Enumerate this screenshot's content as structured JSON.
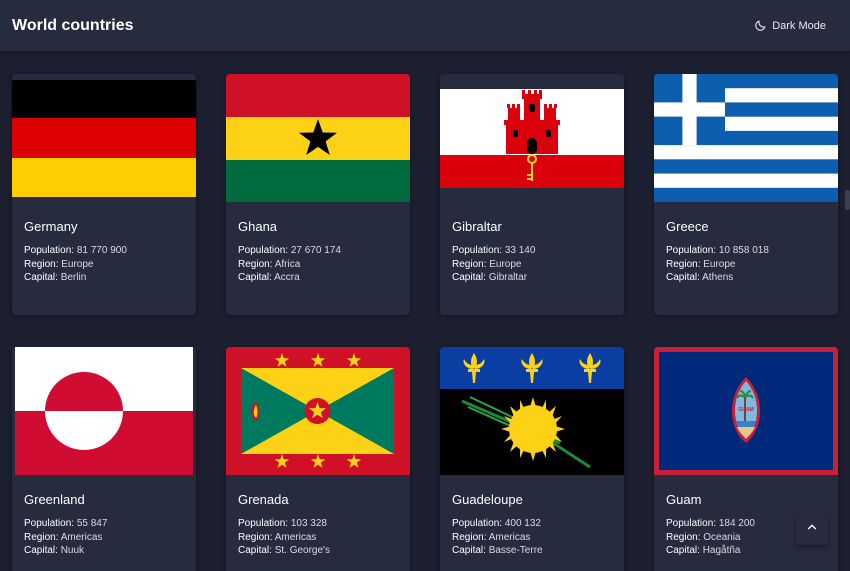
{
  "header": {
    "title": "World countries",
    "mode_label": "Dark Mode",
    "mode_icon": "moon-icon"
  },
  "labels": {
    "population": "Population:",
    "region": "Region:",
    "capital": "Capital:"
  },
  "countries": [
    {
      "name": "Germany",
      "population": "81 770 900",
      "region": "Europe",
      "capital": "Berlin"
    },
    {
      "name": "Ghana",
      "population": "27 670 174",
      "region": "Africa",
      "capital": "Accra"
    },
    {
      "name": "Gibraltar",
      "population": "33 140",
      "region": "Europe",
      "capital": "Gibraltar"
    },
    {
      "name": "Greece",
      "population": "10 858 018",
      "region": "Europe",
      "capital": "Athens"
    },
    {
      "name": "Greenland",
      "population": "55 847",
      "region": "Americas",
      "capital": "Nuuk"
    },
    {
      "name": "Grenada",
      "population": "103 328",
      "region": "Americas",
      "capital": "St. George's"
    },
    {
      "name": "Guadeloupe",
      "population": "400 132",
      "region": "Americas",
      "capital": "Basse-Terre"
    },
    {
      "name": "Guam",
      "population": "184 200",
      "region": "Oceania",
      "capital": "Hagåtña"
    }
  ],
  "scroll_top_icon": "chevron-up-icon",
  "colors": {
    "background": "#1c2030",
    "surface": "#262b3e",
    "text": "#ffffff"
  }
}
